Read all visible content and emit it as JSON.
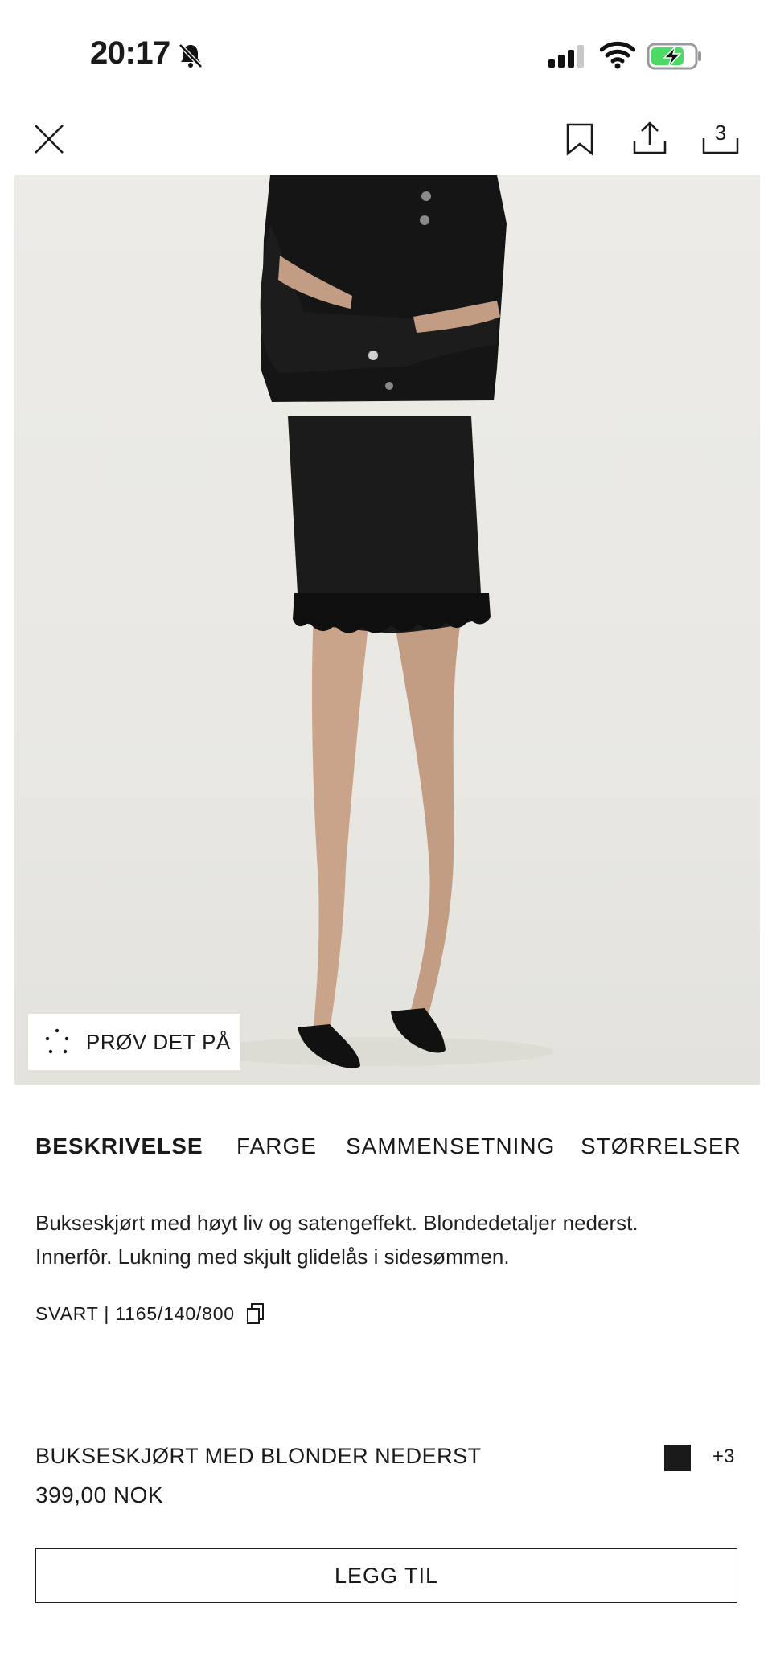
{
  "status_bar": {
    "time": "20:17",
    "icons": [
      "bell-slash-icon",
      "cellular-signal-icon",
      "wifi-icon",
      "battery-charging-icon"
    ]
  },
  "nav": {
    "icons": [
      "close-icon",
      "bookmark-icon",
      "share-icon",
      "gallery-icon"
    ],
    "gallery_count": "3"
  },
  "image": {
    "try_on_label": "PRØV DET PÅ",
    "try_on_icon": "sparkle-icon"
  },
  "tabs": [
    "BESKRIVELSE",
    "FARGE",
    "SAMMENSETNING",
    "STØRRELSER"
  ],
  "active_tab": "BESKRIVELSE",
  "details": {
    "description_line1": "Bukseskjørt med høyt liv og satengeffekt. Blondedetaljer nederst.",
    "description_line2": "Innerfôr. Lukning med skjult glidelås i sidesømmen.",
    "reference": "SVART | 1165/140/800",
    "copy_icon": "copy-icon"
  },
  "product": {
    "name": "BUKSESKJØRT MED BLONDER NEDERST",
    "price": "399,00 NOK",
    "swatch_color": "#1a1a1a",
    "more_colors": "+3"
  },
  "cta": {
    "add_label": "LEGG TIL"
  },
  "colors": {
    "accent": "#1a1a1a",
    "battery_green": "#4cd964",
    "image_background": "#ebeae4"
  }
}
